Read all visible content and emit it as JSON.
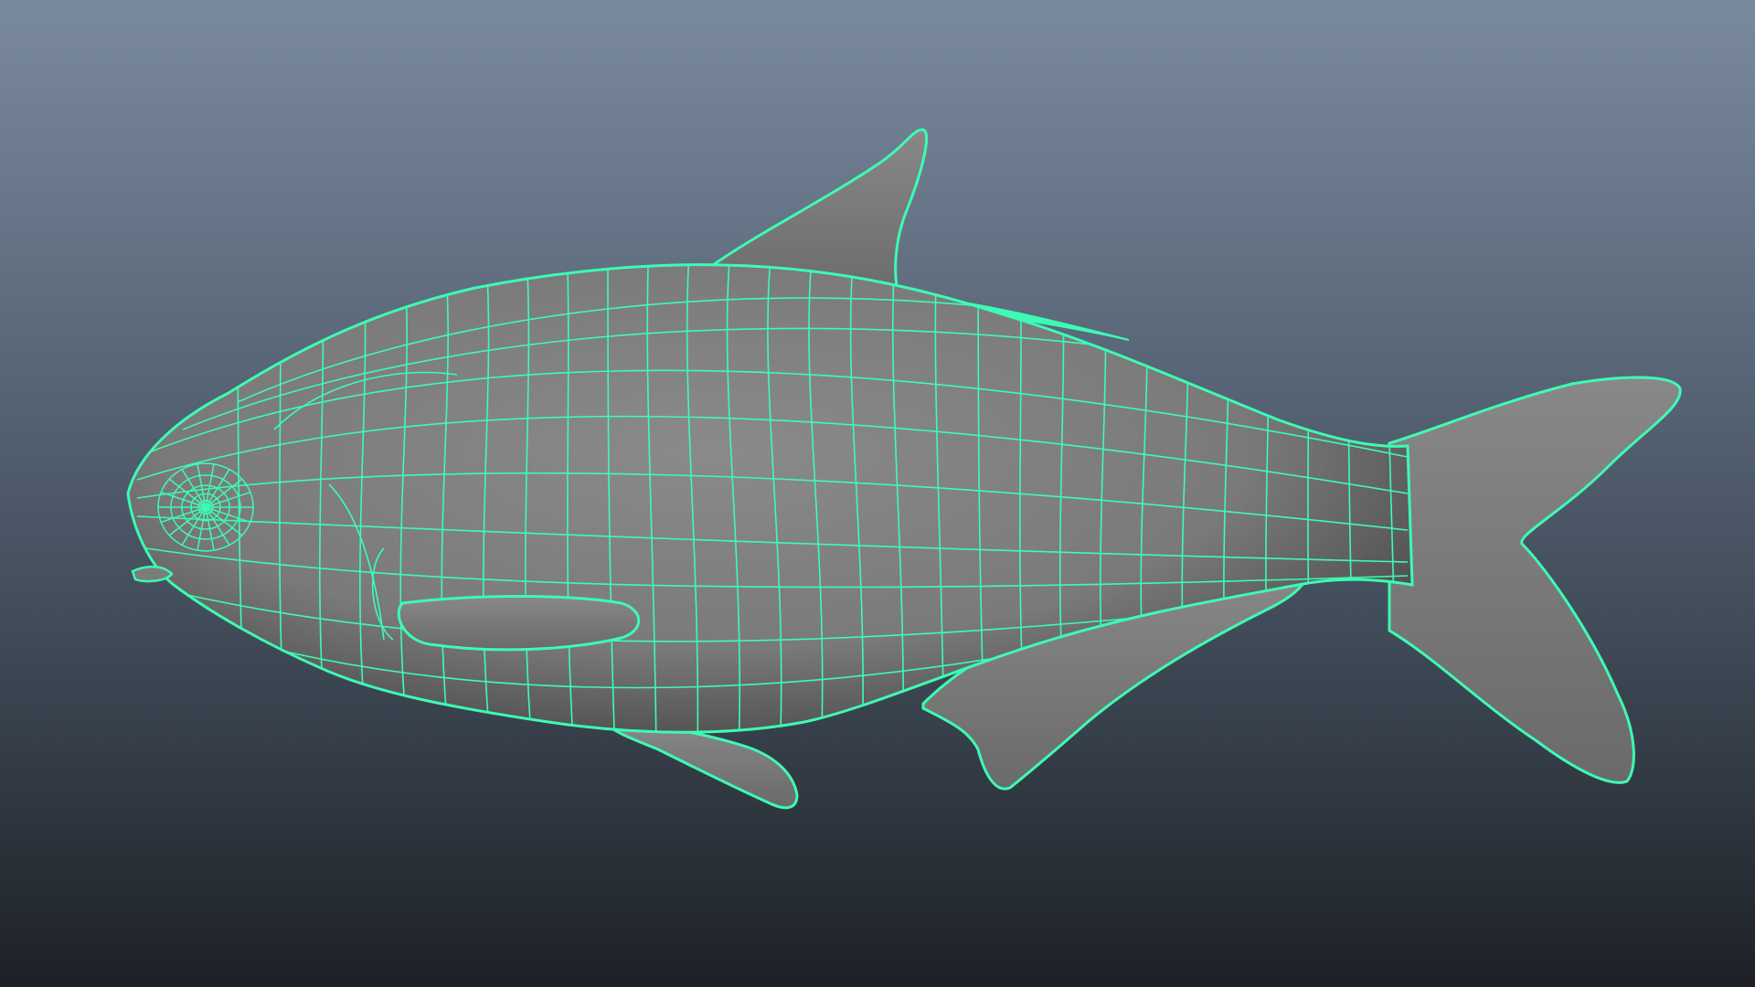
{
  "viewport": {
    "background_top": "#7a8a9d",
    "background_bottom": "#1d2126",
    "caption": ""
  },
  "model": {
    "name": "",
    "wire_color": "#3dfbb4",
    "shade_color": "#7c7c7c",
    "shade_dark": "#4a4a4a"
  }
}
